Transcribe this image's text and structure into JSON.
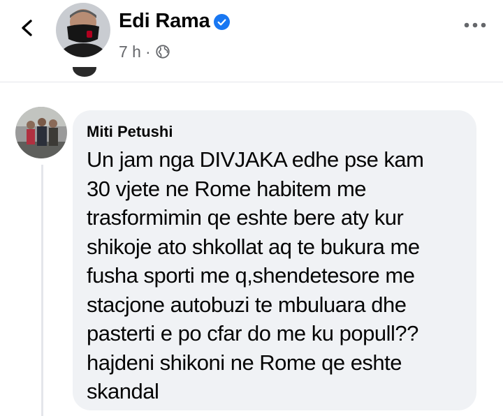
{
  "post": {
    "author": "Edi Rama",
    "time": "7 h",
    "separator": "·",
    "visibility_icon": "globe-icon",
    "verified_icon": "verified-badge-icon",
    "back_icon": "chevron-left-icon",
    "more_icon": "more-dots-icon"
  },
  "comment": {
    "author": "Miti Petushi",
    "text": "Un jam nga DIVJAKA edhe pse kam\n30 vjete ne Rome habitem me\ntrasformimin qe eshte bere aty kur\nshikoje ato shkollat aq te bukura me\nfusha sporti me q,shendetesore me\nstacjone autobuzi te mbuluara dhe\npasterti e po cfar do me ku popull??\nhajdeni shikoni ne Rome qe eshte\nskandal"
  },
  "colors": {
    "primary_text": "#050505",
    "secondary_text": "#65676b",
    "bubble_bg": "#f0f2f5",
    "verified_blue": "#1877f2",
    "divider": "#e4e6eb"
  }
}
